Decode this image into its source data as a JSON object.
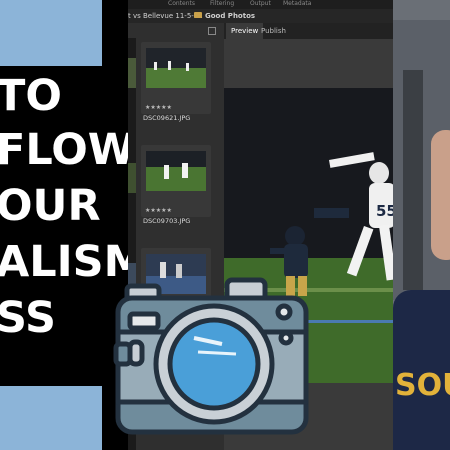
{
  "title_lines": [
    "TO",
    "FLOW",
    "OUR",
    "ALISM",
    "SS"
  ],
  "app": {
    "path_text": "t vs Bellevue 11-5-21",
    "folder_label": "Good Photos",
    "menu_items": [
      "Contents",
      "Filtering",
      "Output",
      "Metadata"
    ],
    "tabs": [
      "Preview",
      "Publish"
    ]
  },
  "thumbnails": [
    {
      "filename": "DSC09621.JPG",
      "rating": "★★★★★"
    },
    {
      "filename": "DSC09703.JPG",
      "rating": "★★★★★"
    },
    {
      "filename": "",
      "rating": ""
    }
  ],
  "main_photo": {
    "jersey_number": "55"
  },
  "webcam": {
    "shirt_text": "SOU"
  },
  "colors": {
    "accent_blue": "#8cb4d8",
    "camera_body": "#6f8c9c",
    "camera_outline": "#23313f",
    "lens_blue": "#4a9fd8"
  },
  "icons": [
    "camera-icon",
    "folder-icon"
  ]
}
